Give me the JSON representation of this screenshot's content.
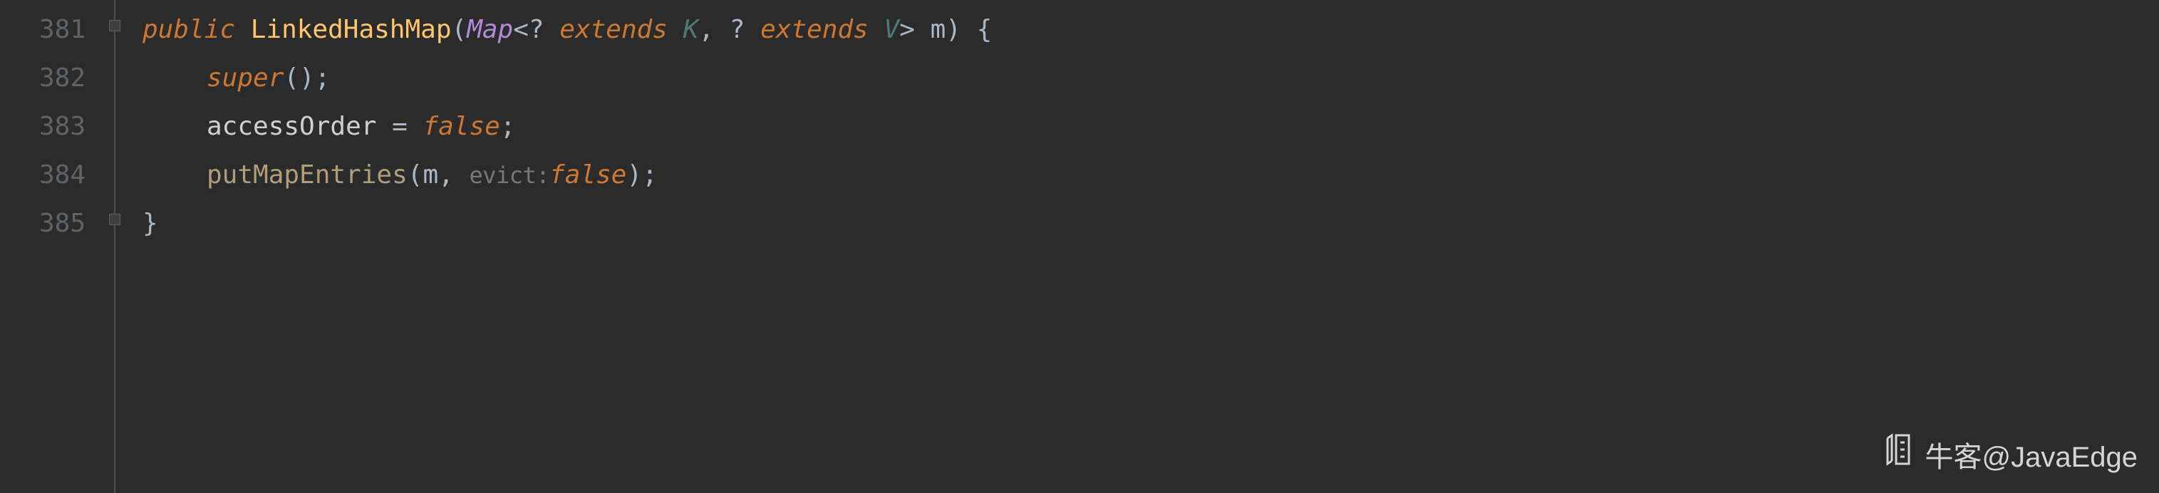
{
  "gutter": {
    "lines": [
      "381",
      "382",
      "383",
      "384",
      "385"
    ]
  },
  "code": {
    "line381": {
      "public": "public",
      "class_name": "LinkedHashMap",
      "map_type": "Map",
      "wildcard1": "?",
      "extends1": "extends",
      "k": "K",
      "wildcard2": "?",
      "extends2": "extends",
      "v": "V",
      "param_m": "m",
      "brace_open": "{"
    },
    "line382": {
      "super_kw": "super",
      "parens": "();"
    },
    "line383": {
      "field": "accessOrder",
      "equals": " = ",
      "false_kw": "false",
      "semi": ";"
    },
    "line384": {
      "method": "putMapEntries",
      "open": "(",
      "arg_m": "m",
      "comma": ", ",
      "hint": "evict:",
      "false_kw": "false",
      "close": ");"
    },
    "line385": {
      "brace_close": "}"
    }
  },
  "watermark": {
    "text": "牛客@JavaEdge"
  }
}
